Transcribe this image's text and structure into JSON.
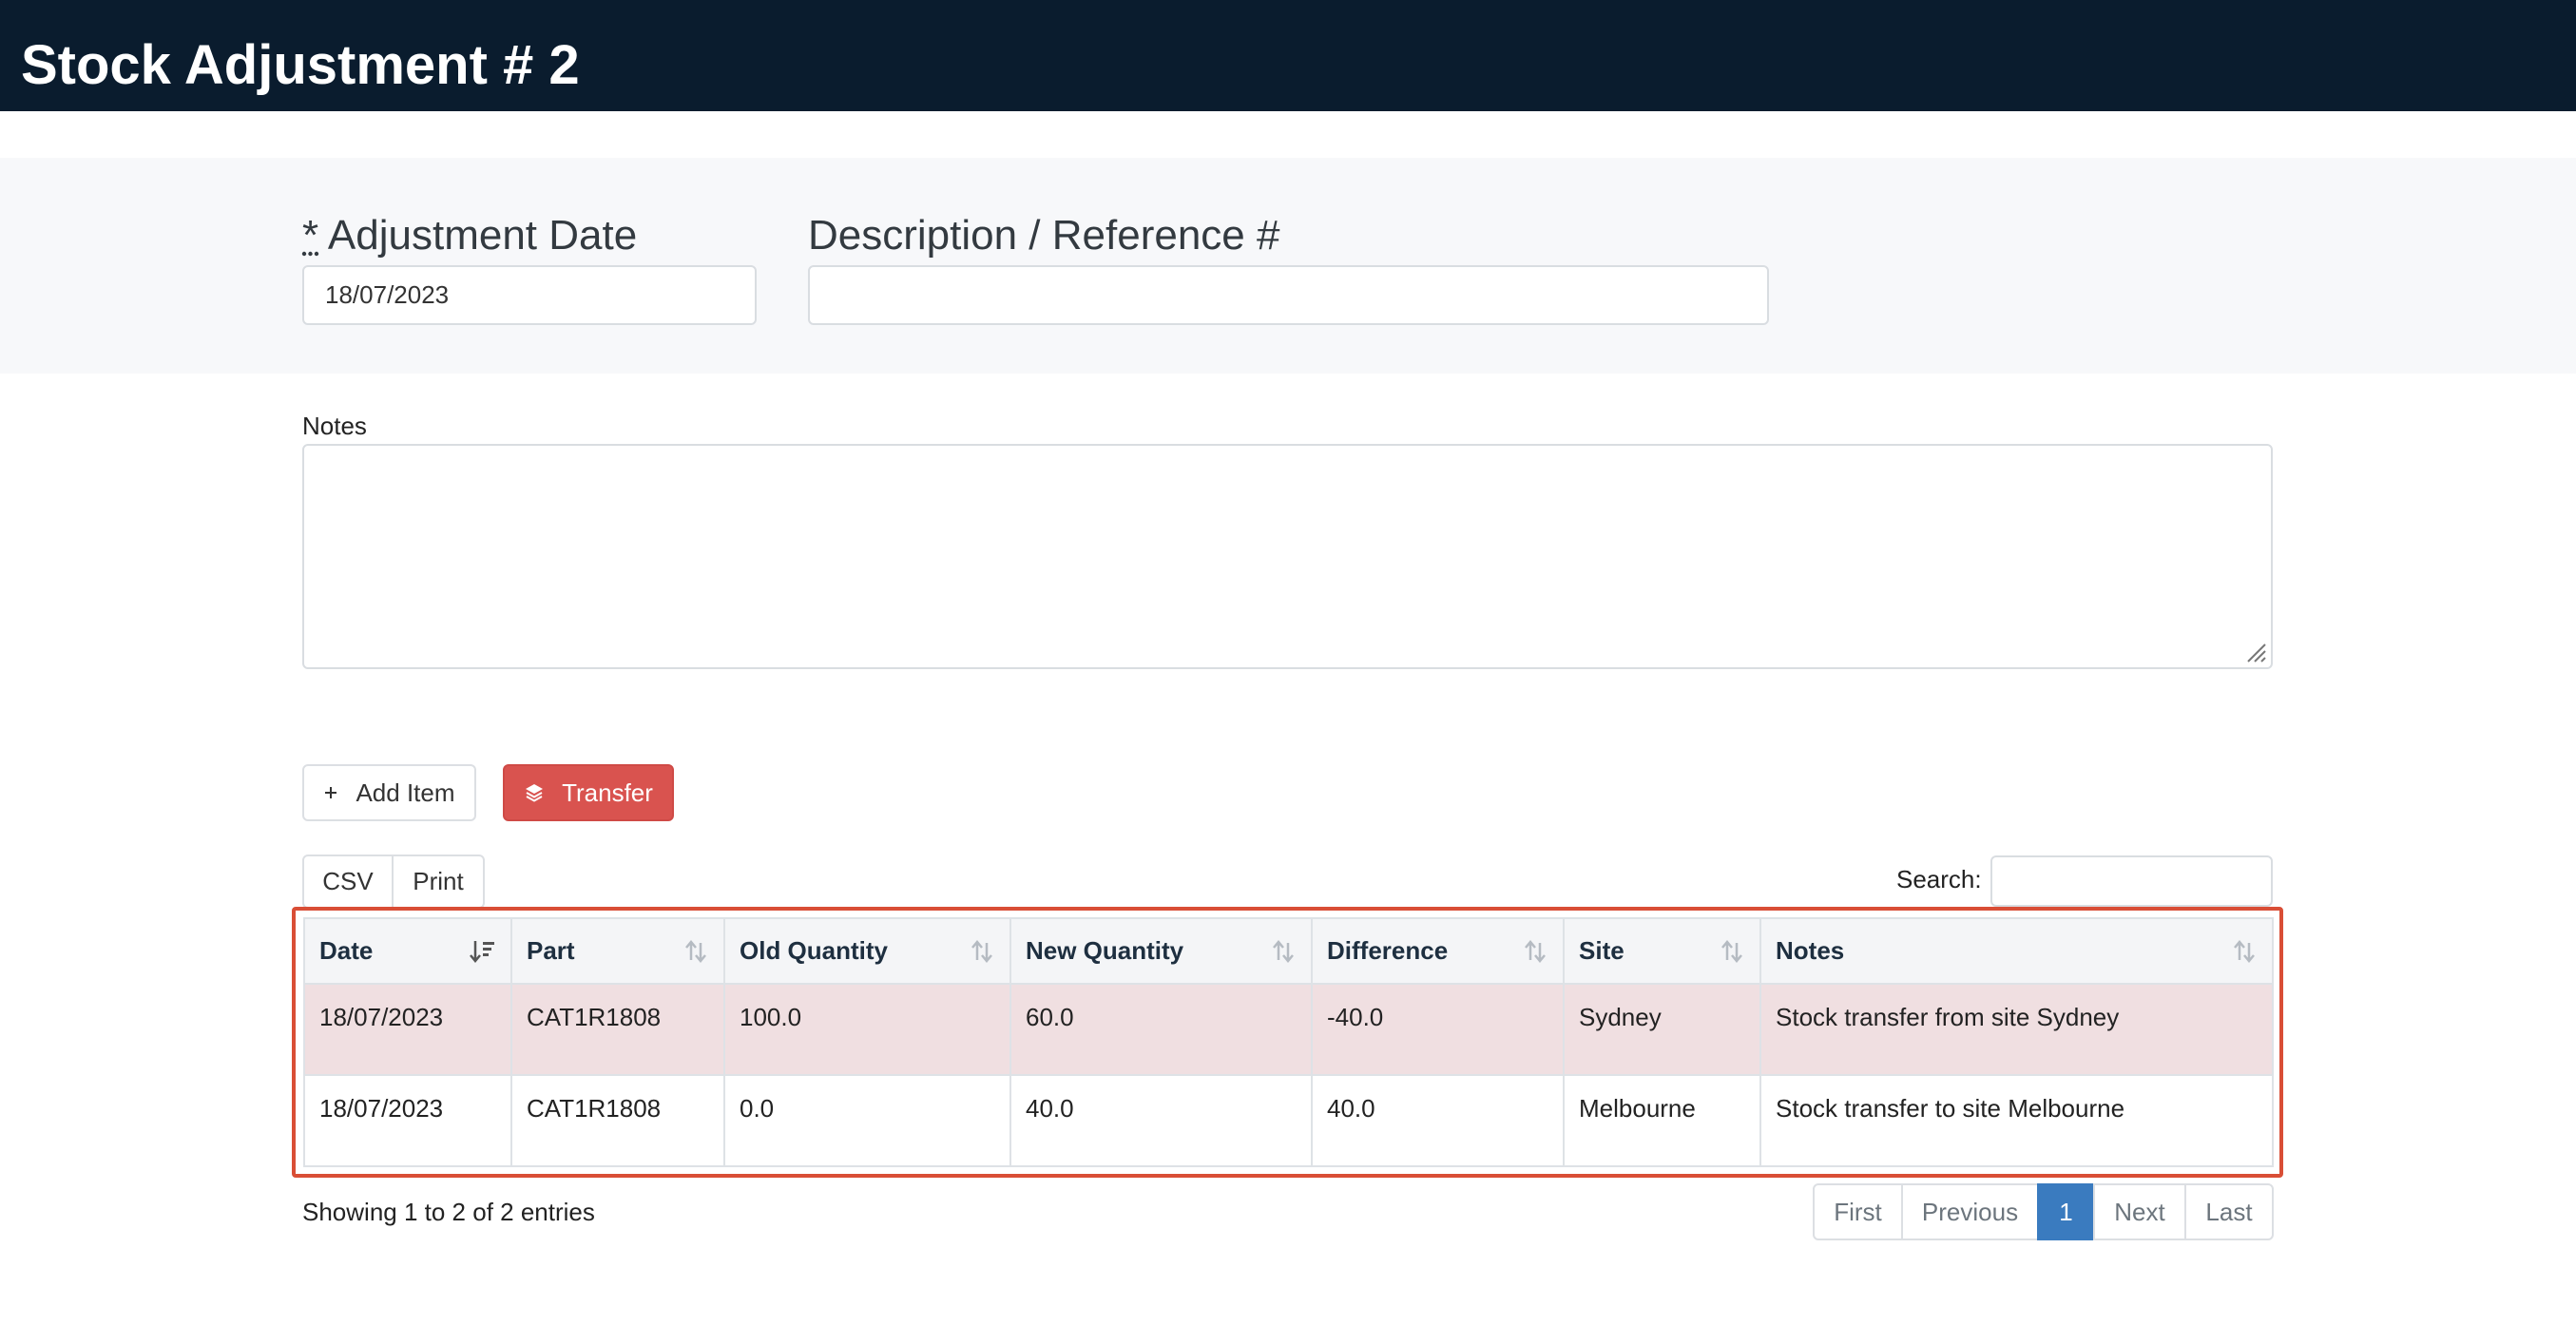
{
  "header": {
    "title": "Stock Adjustment # 2"
  },
  "form": {
    "date_required_mark": "*",
    "date_label": "Adjustment Date",
    "date_value": "18/07/2023",
    "description_label": "Description / Reference #",
    "description_value": "",
    "notes_label": "Notes",
    "notes_value": ""
  },
  "actions": {
    "add_item_icon": "plus-icon",
    "add_item_label": "Add Item",
    "transfer_icon": "layers-icon",
    "transfer_label": "Transfer"
  },
  "table_tools": {
    "csv_label": "CSV",
    "print_label": "Print",
    "search_label": "Search:",
    "search_value": ""
  },
  "table": {
    "columns": [
      "Date",
      "Part",
      "Old Quantity",
      "New Quantity",
      "Difference",
      "Site",
      "Notes"
    ],
    "rows": [
      [
        "18/07/2023",
        "CAT1R1808",
        "100.0",
        "60.0",
        "-40.0",
        "Sydney",
        "Stock transfer from site Sydney"
      ],
      [
        "18/07/2023",
        "CAT1R1808",
        "0.0",
        "40.0",
        "40.0",
        "Melbourne",
        "Stock transfer to site Melbourne"
      ]
    ],
    "sorted_column": "Date"
  },
  "footer": {
    "showing_text": "Showing 1 to 2 of 2 entries",
    "pager": [
      "First",
      "Previous",
      "1",
      "Next",
      "Last"
    ],
    "active_page": "1"
  },
  "colors": {
    "topbar": "#0a1c2e",
    "transfer_button": "#d9534f",
    "active_page": "#3a7bbf",
    "highlight_border": "#d94e36",
    "odd_row": "#f0dfe1"
  }
}
